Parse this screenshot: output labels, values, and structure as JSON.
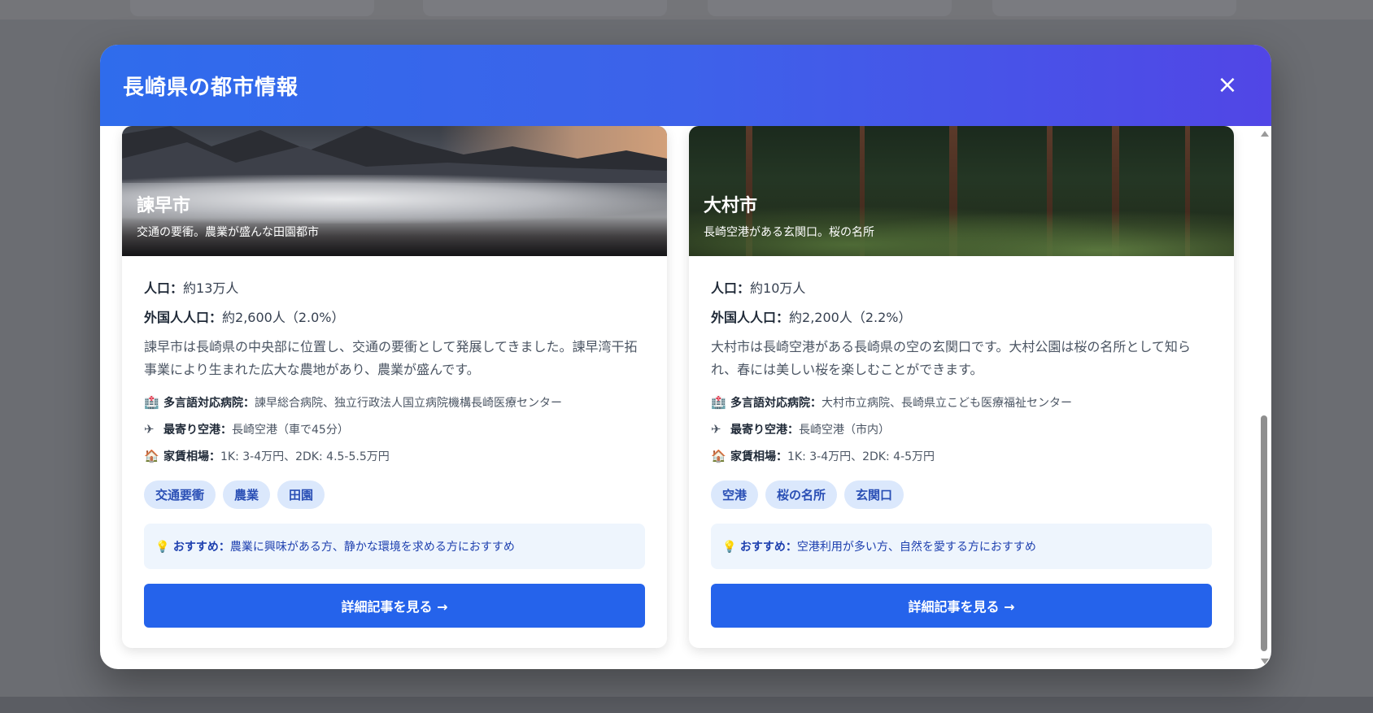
{
  "modal": {
    "title": "長崎県の都市情報",
    "close_icon": "×"
  },
  "cities": [
    {
      "name": "諫早市",
      "tagline": "交通の要衝。農業が盛んな田園都市",
      "population_label": "人口：",
      "population": "約13万人",
      "foreign_label": "外国人人口：",
      "foreign": "約2,600人（2.0%）",
      "description": "諫早市は長崎県の中央部に位置し、交通の要衝として発展してきました。諫早湾干拓事業により生まれた広大な農地があり、農業が盛んです。",
      "hospital_label": "多言語対応病院：",
      "hospital": "諫早総合病院、独立行政法人国立病院機構長崎医療センター",
      "airport_label": "最寄り空港：",
      "airport": "長崎空港（車で45分）",
      "rent_label": "家賃相場：",
      "rent": "1K: 3-4万円、2DK: 4.5-5.5万円",
      "tags": [
        "交通要衝",
        "農業",
        "田園"
      ],
      "recommend_label": "おすすめ：",
      "recommend": "農業に興味がある方、静かな環境を求める方におすすめ",
      "button": "詳細記事を見る →"
    },
    {
      "name": "大村市",
      "tagline": "長崎空港がある玄関口。桜の名所",
      "population_label": "人口：",
      "population": "約10万人",
      "foreign_label": "外国人人口：",
      "foreign": "約2,200人（2.2%）",
      "description": "大村市は長崎空港がある長崎県の空の玄関口です。大村公園は桜の名所として知られ、春には美しい桜を楽しむことができます。",
      "hospital_label": "多言語対応病院：",
      "hospital": "大村市立病院、長崎県立こども医療福祉センター",
      "airport_label": "最寄り空港：",
      "airport": "長崎空港（市内）",
      "rent_label": "家賃相場：",
      "rent": "1K: 3-4万円、2DK: 4-5万円",
      "tags": [
        "空港",
        "桜の名所",
        "玄関口"
      ],
      "recommend_label": "おすすめ：",
      "recommend": "空港利用が多い方、自然を愛する方におすすめ",
      "button": "詳細記事を見る →"
    }
  ],
  "icons": {
    "hospital": "hospital-icon",
    "airport": "airplane-icon",
    "rent": "house-icon",
    "recommend": "lightbulb-icon"
  },
  "colors": {
    "header_start": "#2f6cec",
    "header_end": "#5146e6",
    "button": "#2563eb",
    "tag_bg": "#dbe8fc",
    "tag_text": "#2a4fb5"
  }
}
